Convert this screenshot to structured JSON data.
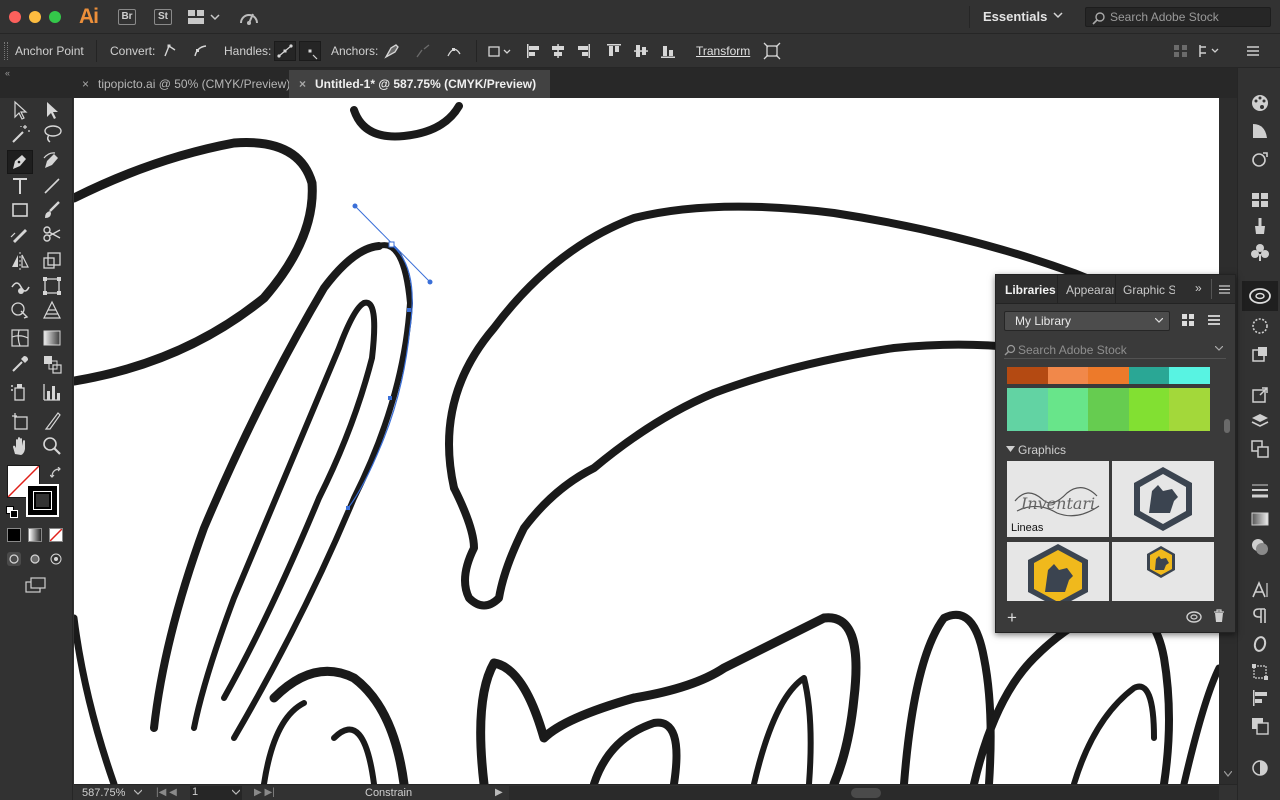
{
  "app": {
    "logo": "Ai",
    "bridge_label": "Br",
    "stock_label": "St",
    "workspace": "Essentials",
    "search_placeholder": "Search Adobe Stock"
  },
  "controlbar": {
    "tool_name": "Anchor Point",
    "convert_label": "Convert:",
    "handles_label": "Handles:",
    "anchors_label": "Anchors:",
    "transform_label": "Transform"
  },
  "tabs": [
    {
      "label": "tipopicto.ai @ 50% (CMYK/Preview)",
      "active": false
    },
    {
      "label": "Untitled-1* @ 587.75% (CMYK/Preview)",
      "active": true
    }
  ],
  "status": {
    "zoom": "587.75%",
    "artboard": "1",
    "mode": "Constrain"
  },
  "libraries": {
    "tabs": [
      "Libraries",
      "Appearan",
      "Graphic S"
    ],
    "selected_library": "My Library",
    "search_placeholder": "Search Adobe Stock",
    "swatch_row1": [
      "#b44a12",
      "#f1884a",
      "#ed7a2a",
      "#2aa795",
      "#58f3e2"
    ],
    "swatch_row2": [
      "#62d3a3",
      "#68e58a",
      "#66cc50",
      "#82e032",
      "#a3d83a"
    ],
    "graphics_header": "Graphics",
    "graphics": [
      {
        "label": "Lineas"
      },
      {
        "label": ""
      },
      {
        "label": ""
      },
      {
        "label": ""
      }
    ]
  },
  "colors": {
    "ui_bg": "#323232",
    "accent_orange": "#ec8f3a",
    "selection_blue": "#3a6fd8",
    "badge_yellow": "#f0b91c",
    "badge_dark": "#3b4450"
  }
}
